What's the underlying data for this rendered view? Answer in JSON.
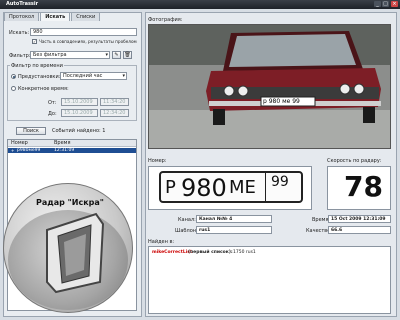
{
  "window": {
    "title": "AutoTrassir",
    "min_label": "_",
    "max_label": "□",
    "close_label": "×"
  },
  "tabs": [
    {
      "label": "Протокол"
    },
    {
      "label": "Искать"
    },
    {
      "label": "Списки"
    }
  ],
  "search": {
    "search_label": "Искать:",
    "search_value": "980",
    "substring_label": "Часть в совпадениях, результаты пробелом",
    "filter_label": "Фильтр:",
    "filter_value": "Без фильтра",
    "time_group_label": "Фильтр по времени",
    "preset_label": "Предустановки:",
    "preset_value": "Последний час",
    "custom_label": "Конкретное время:",
    "from_label": "От:",
    "to_label": "До:",
    "from_date": "15.10.2009",
    "from_time": "11:34:20",
    "to_date": "15.10.2009",
    "to_time": "12:34:20",
    "search_button": "Поиск",
    "events_found": "Событий найдено: 1"
  },
  "results": {
    "columns": [
      "Номер",
      "Время"
    ],
    "rows": [
      {
        "number": "р980ме99",
        "time": "12:31:09"
      }
    ]
  },
  "overlay": {
    "label": "Радар \"Искра\""
  },
  "photo": {
    "label": "Фотография:",
    "plate_text": "р 980 ме 99"
  },
  "plate": {
    "label": "Номер:",
    "letter1": "Р",
    "digits": "980",
    "letters2": "МЕ",
    "region": "99"
  },
  "speed": {
    "label": "Скорость по радару:",
    "value": "78"
  },
  "details": {
    "channel_label": "Канал:",
    "channel_value": "Канал №№ 4",
    "template_label": "Шаблон:",
    "template_value": "rus1",
    "time_label": "Время:",
    "time_value": "15 Oct 2009 12:31:09",
    "quality_label": "Качество:",
    "quality_value": "66.6"
  },
  "found": {
    "label": "Найден в:",
    "list_name": "mikeCorrectList",
    "list_note": "(первый список):",
    "list_value": "1750 rus1"
  }
}
